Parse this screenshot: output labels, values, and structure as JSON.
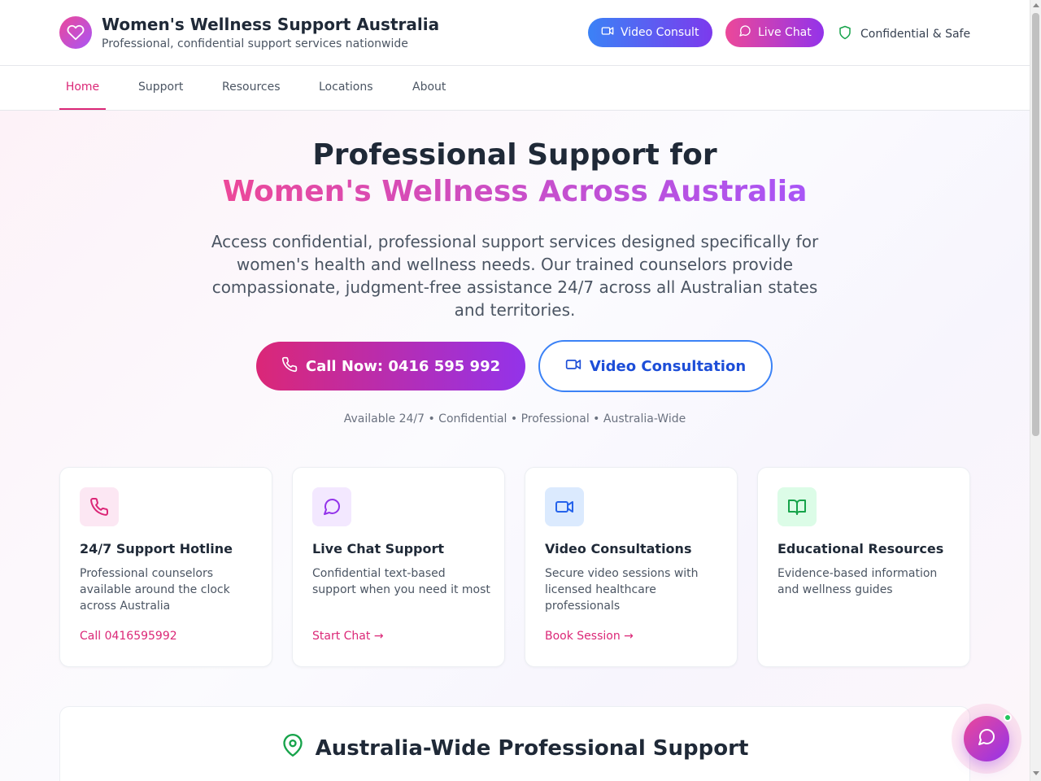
{
  "header": {
    "title": "Women's Wellness Support Australia",
    "subtitle": "Professional, confidential support services nationwide",
    "logo_icon": "heart-icon",
    "video_consult_label": "Video Consult",
    "live_chat_label": "Live Chat",
    "confidential_label": "Confidential & Safe"
  },
  "nav": {
    "items": [
      {
        "label": "Home",
        "active": true
      },
      {
        "label": "Support",
        "active": false
      },
      {
        "label": "Resources",
        "active": false
      },
      {
        "label": "Locations",
        "active": false
      },
      {
        "label": "About",
        "active": false
      }
    ]
  },
  "hero": {
    "headline_line1": "Professional Support for",
    "headline_line2": "Women's Wellness Across Australia",
    "description": "Access confidential, professional support services designed specifically for women's health and wellness needs. Our trained counselors provide compassionate, judgment-free assistance 24/7 across all Australian states and territories.",
    "call_button": "Call Now: 0416 595 992",
    "video_button": "Video Consultation",
    "availability": "Available 24/7 • Confidential • Professional • Australia-Wide"
  },
  "cards": [
    {
      "icon": "phone-icon",
      "title": "24/7 Support Hotline",
      "description": "Professional counselors available around the clock across Australia",
      "link": "Call 0416595992",
      "accent": "#db2777",
      "bg": "#fce7f3"
    },
    {
      "icon": "chat-bubble-icon",
      "title": "Live Chat Support",
      "description": "Confidential text-based support when you need it most",
      "link": "Start Chat →",
      "accent": "#9333ea",
      "bg": "#f3e8ff"
    },
    {
      "icon": "video-camera-icon",
      "title": "Video Consultations",
      "description": "Secure video sessions with licensed healthcare professionals",
      "link": "Book Session →",
      "accent": "#2563eb",
      "bg": "#dbeafe"
    },
    {
      "icon": "book-open-icon",
      "title": "Educational Resources",
      "description": "Evidence-based information and wellness guides",
      "link": "",
      "accent": "#16a34a",
      "bg": "#dcfce7"
    }
  ],
  "section": {
    "title": "Australia-Wide Professional Support",
    "icon": "map-pin-icon"
  },
  "colors": {
    "brand_pink": "#db2777",
    "brand_purple": "#9333ea",
    "brand_blue": "#3b82f6"
  }
}
